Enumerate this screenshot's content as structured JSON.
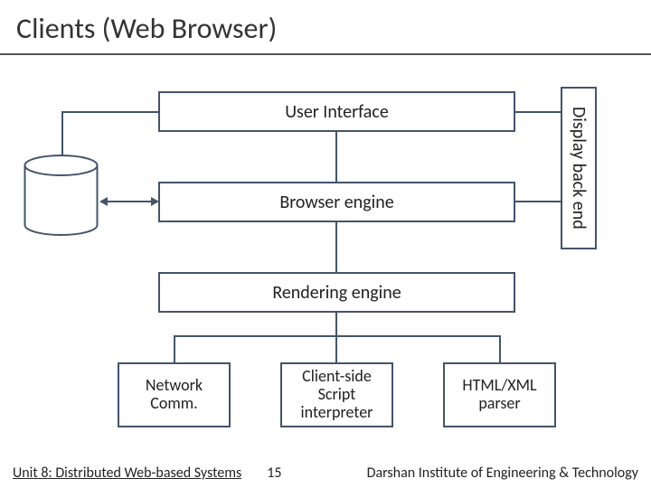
{
  "title": "Clients (Web Browser)",
  "boxes": {
    "ui": "User Interface",
    "be": "Browser engine",
    "re": "Rendering engine",
    "net": "Network\nComm.",
    "cs": "Client-side\nScript\ninterpreter",
    "hx": "HTML/XML\nparser",
    "dbe": "Display back end"
  },
  "footer": {
    "unit": "Unit 8: Distributed Web-based Systems",
    "page": "15",
    "institute": "Darshan Institute of Engineering & Technology"
  }
}
